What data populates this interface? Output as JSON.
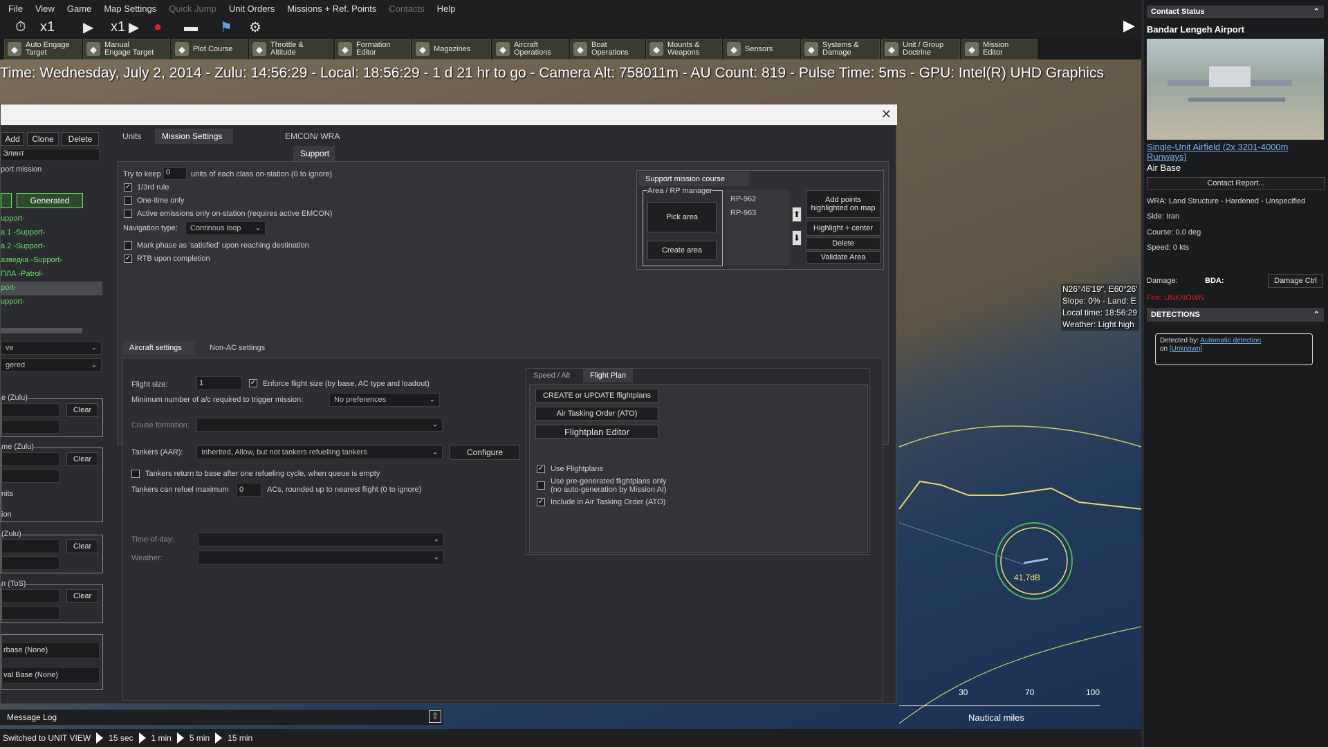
{
  "menu": [
    "File",
    "View",
    "Game",
    "Map Settings",
    "Quick Jump",
    "Unit Orders",
    "Missions + Ref. Points",
    "Contacts",
    "Help"
  ],
  "controls": {
    "speed1": "x1",
    "speed2": "x1"
  },
  "toolbar": [
    {
      "label": "Auto Engage\nTarget",
      "icon": "auto-engage-icon"
    },
    {
      "label": "Manual\nEngage Target",
      "icon": "manual-engage-icon"
    },
    {
      "label": "Plot Course",
      "icon": "plot-course-icon"
    },
    {
      "label": "Throttle &\nAltitude",
      "icon": "throttle-icon"
    },
    {
      "label": "Formation\nEditor",
      "icon": "formation-icon"
    },
    {
      "label": "Magazines",
      "icon": "magazines-icon"
    },
    {
      "label": "Aircraft\nOperations",
      "icon": "aircraft-icon"
    },
    {
      "label": "Boat\nOperations",
      "icon": "boat-icon"
    },
    {
      "label": "Mounts &\nWeapons",
      "icon": "mounts-icon"
    },
    {
      "label": "Sensors",
      "icon": "sensors-icon"
    },
    {
      "label": "Systems &\nDamage",
      "icon": "systems-icon"
    },
    {
      "label": "Unit / Group\nDoctrine",
      "icon": "doctrine-icon"
    },
    {
      "label": "Mission\nEditor",
      "icon": "mission-editor-icon"
    }
  ],
  "status_line": "Time: Wednesday, July 2, 2014 - Zulu: 14:56:29 - Local: 18:56:29 - 1 d 21 hr to go -  Camera Alt: 758011m  - AU Count: 819 - Pulse Time: 5ms - GPU: Intel(R) UHD Graphics",
  "left": {
    "add": "Add",
    "clone": "Clone",
    "delete": "Delete",
    "elint": "Элинт",
    "port_mission": "port mission",
    "generated": "Generated",
    "missions": [
      "upport-",
      "a 1 -Support-",
      "a 2 -Support-",
      "азведка -Support-",
      "ПЛА -Patrol-",
      "port-",
      "upport-"
    ],
    "sel1": "ve",
    "sel2": "gered",
    "zulu1": "e (Zulu)",
    "zulu2": "me (Zulu)",
    "nits": "nits",
    "ion": "ion",
    "zulu3": "(Zulu)",
    "tos": "n (ToS)",
    "clear": "Clear",
    "airbase": "rbase (None)",
    "navalbase": "val Base (None)"
  },
  "tabs": {
    "units": "Units",
    "mission_settings": "Mission Settings",
    "emcon": "EMCON/ WRA",
    "support": "Support"
  },
  "settings": {
    "try_keep": "Try to keep",
    "try_keep_val": "0",
    "try_keep_suffix": "units of each class on-station (0 to ignore)",
    "rule13": "1/3rd rule",
    "one_time": "One-time only",
    "active_emissions": "Active emissions only on-station (requires active EMCON)",
    "nav_type": "Navigation type:",
    "nav_val": "Continous loop",
    "mark_phase": "Mark phase as 'satisfied' upon reaching destination",
    "rtb": "RTB upon completion"
  },
  "course": {
    "title": "Support mission course",
    "area_mgr": "Area / RP manager",
    "pick": "Pick area",
    "create": "Create area",
    "points": [
      "RP-962",
      "RP-963"
    ],
    "add_points": "Add points highlighted on map",
    "highlight": "Highlight + center",
    "delete": "Delete",
    "validate": "Validate Area"
  },
  "ac_tabs": {
    "aircraft": "Aircraft settings",
    "nonac": "Non-AC settings"
  },
  "ac": {
    "flight_size": "Flight size:",
    "flight_size_val": "1",
    "enforce": "Enforce flight size (by base, AC type and loadout)",
    "min_ac": "Minimum number of a/c required to trigger mission:",
    "min_ac_val": "No preferences",
    "cruise": "Cruise formation:",
    "tankers": "Tankers (AAR):",
    "tankers_val": "Inherited, Allow, but not tankers refuelling tankers",
    "configure": "Configure",
    "tankers_return": "Tankers return to base after one refueling cycle, when queue is empty",
    "tankers_max": "Tankers can refuel maximum",
    "tankers_max_val": "0",
    "tankers_max_suffix": "ACs, rounded up to nearest flight (0 to ignore)",
    "tod": "Time-of-day:",
    "weather": "Weather:"
  },
  "fp": {
    "tab_speed": "Speed / Alt",
    "tab_plan": "Flight Plan",
    "create": "CREATE or UPDATE flightplans",
    "ato": "Air Tasking Order (ATO)",
    "editor": "Flightplan Editor",
    "use": "Use Flightplans",
    "pregen": "Use pre-generated flightplans only\n(no auto-generation by Mission AI)",
    "include": "Include in Air Tasking Order (ATO)"
  },
  "map": {
    "coords": "N26°46'19\", E60°26'",
    "slope": "Slope: 0%  - Land: E",
    "local": "Local time: 18:56:29",
    "weather": "Weather: Light high",
    "db": "41,7dB",
    "scale": [
      "30",
      "70",
      "100"
    ],
    "scale_unit": "Nautical miles"
  },
  "contact": {
    "header": "Contact Status",
    "name": "Bandar Lengeh Airport",
    "type_link": "Single-Unit Airfield (2x 3201-4000m Runways)",
    "type": "Air Base",
    "report": "Contact Report...",
    "wra": "WRA: Land Structure - Hardened - Unspecified",
    "side": "Side: Iran",
    "course": "Course: 0,0 deg",
    "speed": "Speed: 0 kts",
    "damage": "Damage:",
    "bda": "BDA:",
    "damage_ctrl": "Damage Ctrl",
    "fire": "Fire: UNKNOWN",
    "detections": "DETECTIONS",
    "detected_by": "Detected by:",
    "auto_det": "Automatic detection",
    "on": "on",
    "unknown": "[Unknown]"
  },
  "bottom": {
    "log": "Message Log",
    "switched": "Switched to UNIT VIEW",
    "t1": "15 sec",
    "t2": "1 min",
    "t3": "5 min",
    "t4": "15 min"
  },
  "colors": {
    "accent_green": "#6fdc6f",
    "fire_red": "#d02020",
    "link_blue": "#7ab0e8"
  }
}
